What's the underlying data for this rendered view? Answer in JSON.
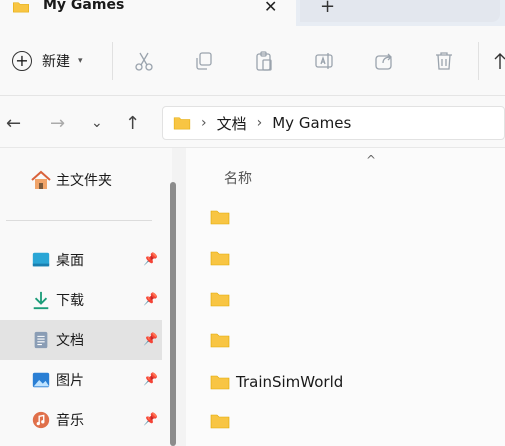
{
  "tab": {
    "title": "My Games",
    "close": "✕",
    "new_tab": "+"
  },
  "toolbar": {
    "new_label": "新建",
    "new_icon": "plus-circle-icon",
    "caret": "⌄",
    "tools": [
      "cut-icon",
      "copy-icon",
      "paste-icon",
      "rename-icon",
      "share-icon",
      "delete-icon",
      "sort-icon"
    ]
  },
  "nav": {
    "back": "←",
    "forward": "→",
    "recent": "⌄",
    "up": "↑",
    "breadcrumb": [
      "文档",
      "My Games"
    ],
    "sep": "›"
  },
  "sidebar": {
    "home": "主文件夹",
    "items": [
      {
        "label": "桌面",
        "icon": "desktop-icon"
      },
      {
        "label": "下载",
        "icon": "download-icon"
      },
      {
        "label": "文档",
        "icon": "document-icon"
      },
      {
        "label": "图片",
        "icon": "picture-icon"
      },
      {
        "label": "音乐",
        "icon": "music-icon"
      }
    ],
    "pin": "📌"
  },
  "content": {
    "column_name": "名称",
    "sort_indicator": "^",
    "files": [
      "",
      "",
      "",
      "",
      "TrainSimWorld",
      ""
    ]
  },
  "colors": {
    "folder": "#f8c543",
    "folder_dark": "#e8a800",
    "selected": "#e3e3e3"
  }
}
